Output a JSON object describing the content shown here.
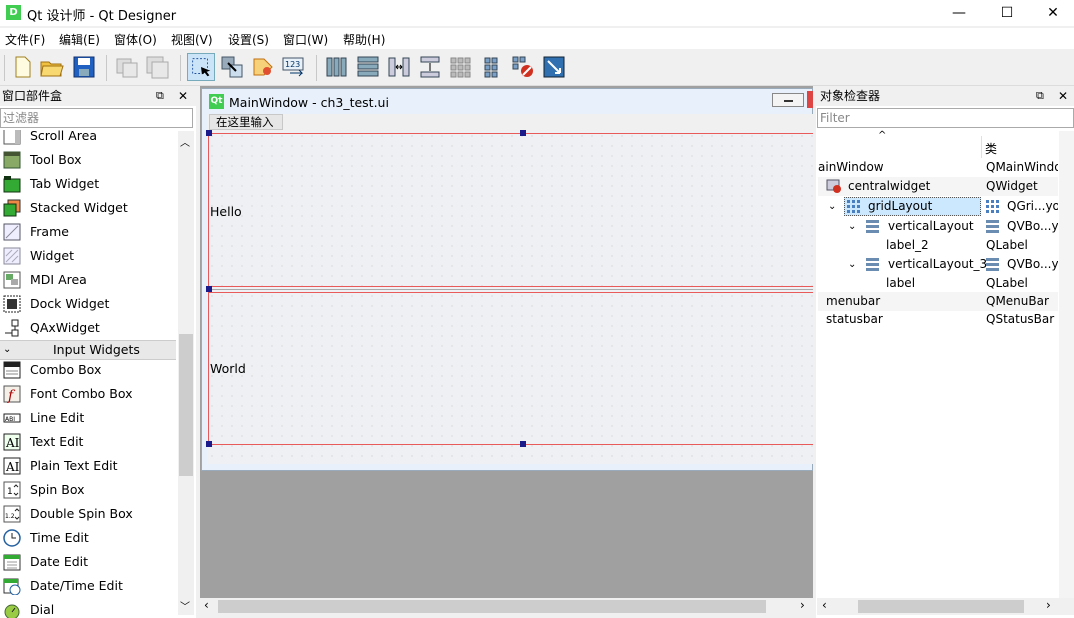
{
  "window": {
    "title": "Qt 设计师 - Qt Designer",
    "app_icon_text": "D",
    "minimize": "—",
    "maximize": "☐",
    "close": "✕"
  },
  "menubar": [
    "文件(F)",
    "编辑(E)",
    "窗体(O)",
    "视图(V)",
    "设置(S)",
    "窗口(W)",
    "帮助(H)"
  ],
  "toolbar_icons": [
    "new-file-icon",
    "open-file-icon",
    "save-icon",
    "cut-disabled-icon",
    "copy-disabled-icon",
    "edit-widgets-icon",
    "edit-signals-slots-icon",
    "edit-buddies-icon",
    "edit-tab-order-icon",
    "layout-horizontal-icon",
    "layout-vertical-icon",
    "layout-horizontal-splitter-icon",
    "layout-vertical-splitter-icon",
    "layout-grid-icon",
    "layout-form-icon",
    "break-layout-icon",
    "adjust-size-icon"
  ],
  "widget_box": {
    "title": "窗口部件盒",
    "filter_placeholder": "过滤器",
    "items_containers": [
      "Scroll Area",
      "Tool Box",
      "Tab Widget",
      "Stacked Widget",
      "Frame",
      "Widget",
      "MDI Area",
      "Dock Widget",
      "QAxWidget"
    ],
    "input_header": "Input Widgets",
    "items_input": [
      "Combo Box",
      "Font Combo Box",
      "Line Edit",
      "Text Edit",
      "Plain Text Edit",
      "Spin Box",
      "Double Spin Box",
      "Time Edit",
      "Date Edit",
      "Date/Time Edit",
      "Dial"
    ]
  },
  "subwindow": {
    "title": "MainWindow - ch3_test.ui",
    "icon_text": "Qt",
    "menu_placeholder": "在这里输入",
    "label_hello": "Hello",
    "label_world": "World"
  },
  "object_inspector": {
    "title": "对象检查器",
    "filter_placeholder": "Filter",
    "header_sort": "^",
    "header_class": "类",
    "rows": [
      {
        "name": "ainWindow",
        "class": "QMainWindo"
      },
      {
        "name": "centralwidget",
        "class": "QWidget"
      },
      {
        "name": "gridLayout",
        "class": "QGri...yo"
      },
      {
        "name": "verticalLayout",
        "class": "QVBo...yo"
      },
      {
        "name": "label_2",
        "class": "QLabel"
      },
      {
        "name": "verticalLayout_3",
        "class": "QVBo...yo"
      },
      {
        "name": "label",
        "class": "QLabel"
      },
      {
        "name": "menubar",
        "class": "QMenuBar"
      },
      {
        "name": "statusbar",
        "class": "QStatusBar"
      }
    ]
  },
  "colors": {
    "qt_green": "#41cd52",
    "selection": "#cce8ff",
    "layout_red": "#e85a5a"
  }
}
